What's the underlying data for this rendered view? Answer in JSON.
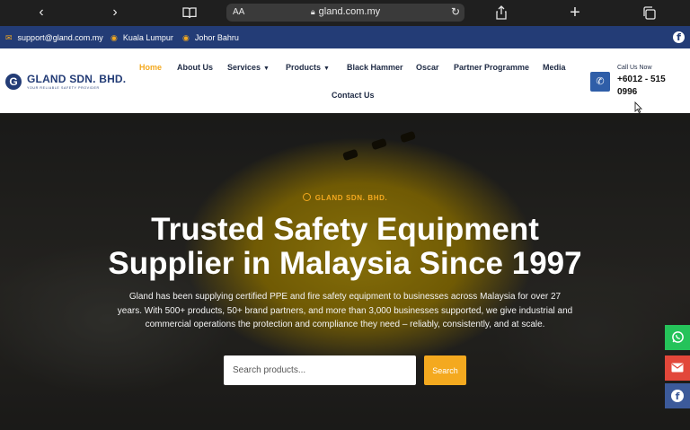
{
  "browser": {
    "back_icon": "chevron-left-icon",
    "forward_icon": "chevron-right-icon",
    "book_icon": "book-icon",
    "text_size": "AA",
    "url": "gland.com.my",
    "share_icon": "share-icon",
    "new_tab_icon": "plus-icon",
    "tabs_icon": "tabs-icon"
  },
  "topbar": {
    "email": "support@gland.com.my",
    "location1": "Kuala Lumpur",
    "location2": "Johor Bahru",
    "facebook_icon": "facebook-icon"
  },
  "logo": {
    "name": "GLAND SDN. BHD.",
    "tagline": "YOUR RELIABLE SAFETY PROVIDER"
  },
  "nav": {
    "items": [
      {
        "label": "Home",
        "active": true
      },
      {
        "label": "About Us"
      },
      {
        "label": "Services",
        "dropdown": true
      },
      {
        "label": "Products",
        "dropdown": true
      },
      {
        "label": "Black Hammer"
      },
      {
        "label": "Oscar"
      },
      {
        "label": "Partner Programme"
      },
      {
        "label": "Media"
      },
      {
        "label": "Contact Us"
      }
    ]
  },
  "call": {
    "label": "Call Us Now",
    "number": "+6012 - 515 0996"
  },
  "hero": {
    "eyebrow": "GLAND SDN. BHD.",
    "title_line1": "Trusted Safety Equipment",
    "title_line2": "Supplier in Malaysia Since 1997",
    "description": "Gland has been supplying certified PPE and fire safety equipment to businesses across Malaysia for over 27 years. With 500+ products, 50+ brand partners, and more than 3,000 businesses supported, we give industrial and commercial operations the protection and compliance they need – reliably, consistently, and at scale.",
    "search_placeholder": "Search products...",
    "search_button": "Search"
  },
  "floating": {
    "whatsapp_icon": "whatsapp-icon",
    "email_icon": "email-icon",
    "facebook_icon": "facebook-icon"
  },
  "colors": {
    "accent": "#f4a91f",
    "brand": "#233c76",
    "whatsapp": "#25c35a",
    "email": "#e2473a",
    "facebook": "#3c5a9a"
  }
}
